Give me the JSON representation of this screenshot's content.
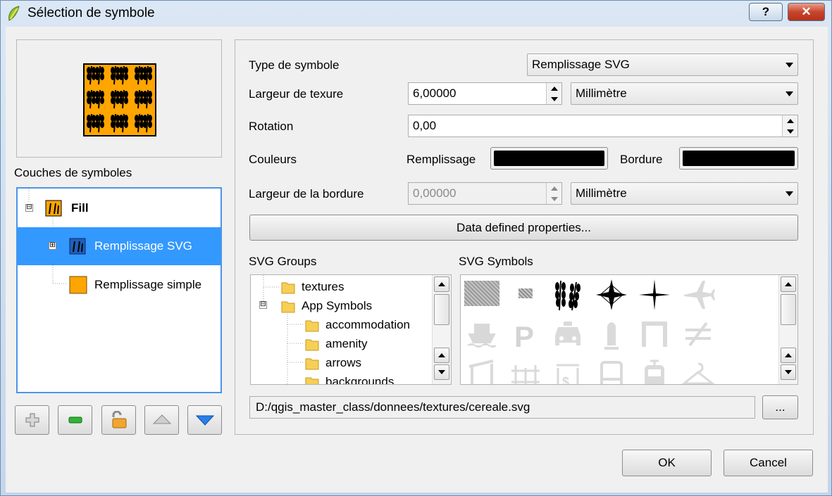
{
  "window": {
    "title": "Sélection de symbole",
    "help_label": "?",
    "close_label": "✕"
  },
  "left": {
    "layers_label": "Couches de symboles",
    "tree": [
      {
        "label": "Fill",
        "expander": "⊟"
      },
      {
        "label": "Remplissage SVG",
        "expander": "⊞"
      },
      {
        "label": "Remplissage simple",
        "expander": ""
      }
    ]
  },
  "form": {
    "symbol_type_label": "Type de symbole",
    "symbol_type_value": "Remplissage SVG",
    "texture_width_label": "Largeur de texure",
    "texture_width_value": "6,00000",
    "texture_unit": "Millimètre",
    "rotation_label": "Rotation",
    "rotation_value": "0,00",
    "colors_label": "Couleurs",
    "fill_label": "Remplissage",
    "fill_color": "#000000",
    "border_label": "Bordure",
    "border_color": "#000000",
    "border_width_label": "Largeur de la bordure",
    "border_width_value": "0,00000",
    "border_unit": "Millimètre",
    "data_defined_label": "Data defined properties..."
  },
  "svg_groups": {
    "label": "SVG Groups",
    "items": [
      "textures",
      "App Symbols",
      "accommodation",
      "amenity",
      "arrows",
      "backgrounds"
    ],
    "expander": "⊟"
  },
  "svg_symbols": {
    "label": "SVG Symbols",
    "icons": [
      "noise-texture-icon",
      "small-texture-icon",
      "wheat-icon",
      "star-4-point-icon",
      "sparkle-icon",
      "airplane-icon",
      "ferry-icon",
      "parking-icon",
      "taxi-icon",
      "statue-icon",
      "gate-icon",
      "not-equal-icon",
      "bar-icon",
      "fence-icon",
      "atm-icon",
      "bus-icon",
      "tram-icon",
      "hanger-icon"
    ]
  },
  "path": {
    "value": "D:/qgis_master_class/donnees/textures/cereale.svg",
    "browse_label": "..."
  },
  "buttons": {
    "ok": "OK",
    "cancel": "Cancel"
  },
  "colors": {
    "accent": "#3399ff",
    "preview_fill": "#ffa500"
  }
}
